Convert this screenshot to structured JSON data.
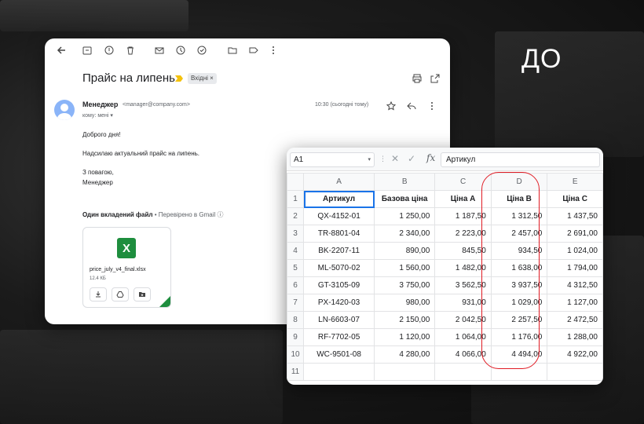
{
  "overlay_title": "ДО",
  "email": {
    "subject": "Прайс на липень",
    "label": "Вхідні",
    "sender_name": "Менеджер",
    "sender_email": "<manager@company.com>",
    "recipient": "кому: мені",
    "time": "10:30 (сьогодні тому)",
    "body": [
      "Доброго дня!",
      "Надсилаю актуальний прайс на липень.",
      "З повагою,",
      "Менеджер"
    ],
    "attachments_heading": "Один вкладений файл",
    "scan_note": "Перевірено в Gmail",
    "attachment": {
      "file_name": "price_july_v4_final.xlsx",
      "size": "12.4 КБ",
      "type_letter": "X"
    }
  },
  "spreadsheet": {
    "name_box": "A1",
    "formula": "Артикул",
    "columns": [
      "A",
      "B",
      "C",
      "D",
      "E"
    ],
    "row_numbers": [
      "1",
      "2",
      "3",
      "4",
      "5",
      "6",
      "7",
      "8",
      "9",
      "10",
      "11"
    ],
    "headers": [
      "Артикул",
      "Базова ціна",
      "Ціна A",
      "Ціна B",
      "Ціна C"
    ],
    "rows": [
      [
        "QX-4152-01",
        "1 250,00",
        "1 187,50",
        "1 312,50",
        "1 437,50"
      ],
      [
        "TR-8801-04",
        "2 340,00",
        "2 223,00",
        "2 457,00",
        "2 691,00"
      ],
      [
        "BK-2207-11",
        "890,00",
        "845,50",
        "934,50",
        "1 024,00"
      ],
      [
        "ML-5070-02",
        "1 560,00",
        "1 482,00",
        "1 638,00",
        "1 794,00"
      ],
      [
        "GT-3105-09",
        "3 750,00",
        "3 562,50",
        "3 937,50",
        "4 312,50"
      ],
      [
        "PX-1420-03",
        "980,00",
        "931,00",
        "1 029,00",
        "1 127,00"
      ],
      [
        "LN-6603-07",
        "2 150,00",
        "2 042,50",
        "2 257,50",
        "2 472,50"
      ],
      [
        "RF-7702-05",
        "1 120,00",
        "1 064,00",
        "1 176,00",
        "1 288,00"
      ],
      [
        "WC-9501-08",
        "4 280,00",
        "4 066,00",
        "4 494,00",
        "4 922,00"
      ],
      [
        "",
        "",
        "",
        "",
        ""
      ]
    ],
    "highlighted_column": "D",
    "highlight_color": "#e01b24"
  }
}
